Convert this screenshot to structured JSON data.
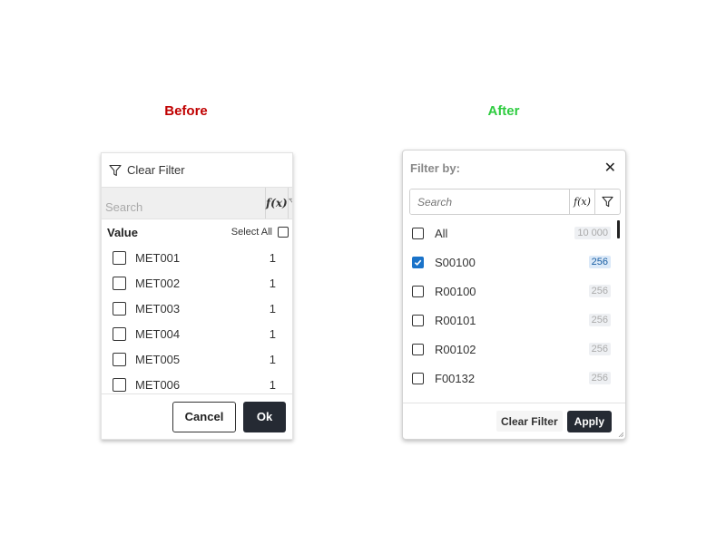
{
  "labels": {
    "before": "Before",
    "after": "After"
  },
  "colors": {
    "before_caption": "#c00000",
    "after_caption": "#2ecc40",
    "primary_button": "#252a33",
    "checkbox_checked": "#1a73c9"
  },
  "before": {
    "header": {
      "icon": "funnel-icon",
      "label": "Clear Filter"
    },
    "search": {
      "placeholder": "Search",
      "value": ""
    },
    "fx_label": "f(x)",
    "value_header": "Value",
    "select_all_label": "Select All",
    "items": [
      {
        "label": "MET001",
        "count": "1"
      },
      {
        "label": "MET002",
        "count": "1"
      },
      {
        "label": "MET003",
        "count": "1"
      },
      {
        "label": "MET004",
        "count": "1"
      },
      {
        "label": "MET005",
        "count": "1"
      },
      {
        "label": "MET006",
        "count": "1"
      }
    ],
    "cancel_label": "Cancel",
    "ok_label": "Ok"
  },
  "after": {
    "title": "Filter by:",
    "close_label": "✕",
    "search": {
      "placeholder": "Search",
      "value": ""
    },
    "fx_label": "f(x)",
    "items": [
      {
        "label": "All",
        "count": "10 000",
        "checked": false
      },
      {
        "label": "S00100",
        "count": "256",
        "checked": true
      },
      {
        "label": "R00100",
        "count": "256",
        "checked": false
      },
      {
        "label": "R00101",
        "count": "256",
        "checked": false
      },
      {
        "label": "R00102",
        "count": "256",
        "checked": false
      },
      {
        "label": "F00132",
        "count": "256",
        "checked": false
      }
    ],
    "clear_label": "Clear Filter",
    "apply_label": "Apply"
  }
}
